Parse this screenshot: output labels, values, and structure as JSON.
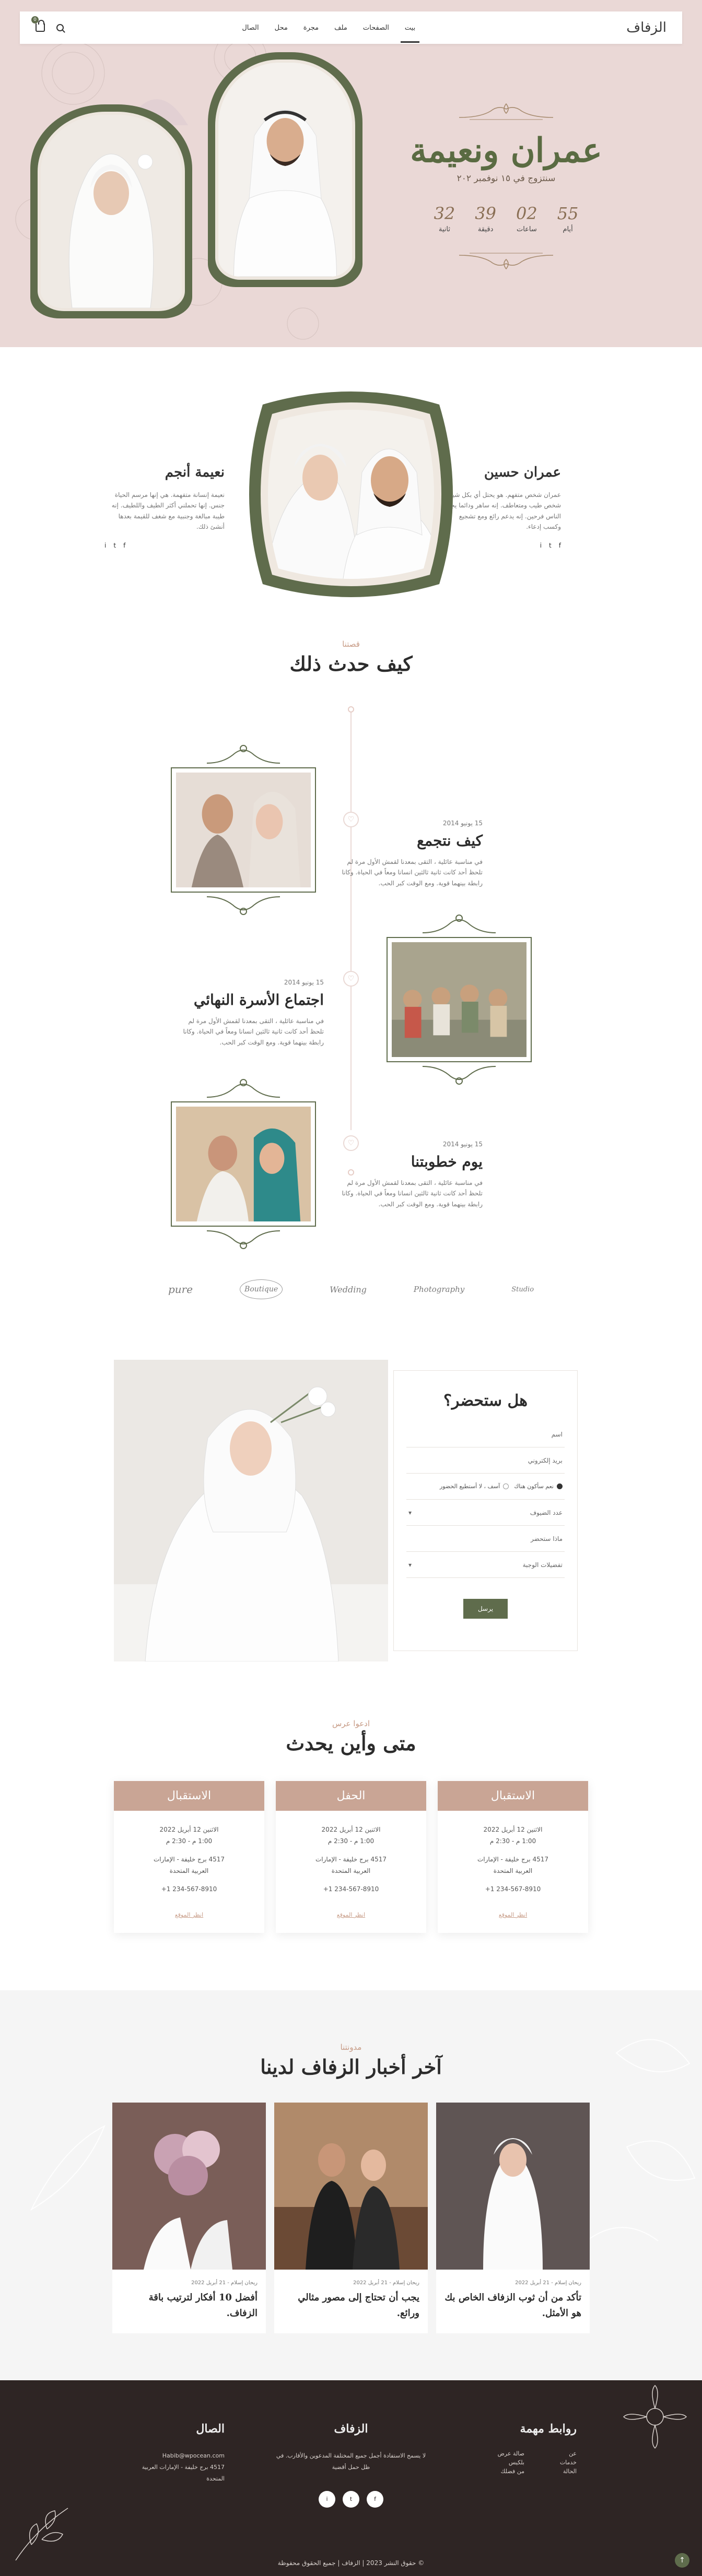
{
  "nav": {
    "logo": "الزفاف",
    "links": [
      "بيت",
      "الصفحات",
      "ملف",
      "مجرة",
      "محل",
      "الصال"
    ],
    "cart_count": "0"
  },
  "hero": {
    "names": "عمران ونعيمة",
    "date": "سنتزوج في ١٥ نوفمبر ٢٠٢",
    "countdown": [
      {
        "num": "55",
        "label": "أيام"
      },
      {
        "num": "02",
        "label": "ساعات"
      },
      {
        "num": "39",
        "label": "دقيقة"
      },
      {
        "num": "32",
        "label": "ثانية"
      }
    ]
  },
  "couple": {
    "groom": {
      "name": "عمران حسين",
      "bio": "عمران شخص متفهم. هو يحتل أي بكل شيك . شخص طيب ومتعاطف. إنه ساهر ودائما يجعل الناس فرحين. إنه يدعم رائع ومع تشجيع وكسب إدعاء.",
      "socials": [
        "f",
        "t",
        "i"
      ]
    },
    "bride": {
      "name": "نعيمة أنجم",
      "bio": "نعيمة إنسانة متفهمة. هي إنها مرسم الحياة جنس. إنها تحملني أكثر الطيف واللطيف. إنه طيبة مبالغة وجنبية مع شغف للقيمة بعدها أنشئ ذلك.",
      "socials": [
        "f",
        "t",
        "i"
      ]
    }
  },
  "story": {
    "eyebrow": "قصتنا",
    "title": "كيف حدث ذلك",
    "items": [
      {
        "date": "15 يونيو 2014",
        "title": "كيف نتجمع",
        "text": "في مناسبة عائلية ، التقى بمعدنا لقمش الأول مرة لم تلحظ أحد كانت ثانية ثالثين انسانا ومعاً في الحياة. وكانا رابطة بينهما قوية. ومع الوقت كبر الحب."
      },
      {
        "date": "15 يونيو 2014",
        "title": "اجتماع الأسرة النهائي",
        "text": "في مناسبة عائلية ، التقى بمعدنا لقمش الأول مرة لم تلحظ أحد كانت ثانية ثالثين انسانا ومعاً في الحياة. وكانا رابطة بينهما قوية. ومع الوقت كبر الحب."
      },
      {
        "date": "15 يونيو 2014",
        "title": "يوم خطوبتنا",
        "text": "في مناسبة عائلية ، التقى بمعدنا لقمش الأول مرة لم تلحظ أحد كانت ثانية ثالثين انسانا ومعاً في الحياة. وكانا رابطة بينهما قوية. ومع الوقت كبر الحب."
      }
    ]
  },
  "brands": [
    "pure",
    "Boutique",
    "Wedding",
    "Photography",
    "Studio"
  ],
  "rsvp": {
    "title": "هل ستحضر؟",
    "fields": {
      "name": "اسم",
      "email": "بريد إلكتروني",
      "attend_yes": "نعم سأكون هناك",
      "attend_no": "آسف ، لا أستطيع الحضور",
      "guests": "عدد الضيوف",
      "meal": "ماذا ستحضر",
      "pref": "تفضيلات الوجبة"
    },
    "submit": "يرسل"
  },
  "when": {
    "eyebrow": "ادعوا عرس",
    "title": "متى وأين يحدث",
    "events": [
      {
        "name": "الاستقبال",
        "date": "الاثنين 12 أبريل 2022",
        "time": "1:00 م - 2:30 م",
        "addr1": "4517 برج خليفة - الإمارات",
        "addr2": "العربية المتحدة",
        "phone": "+1 234-567-8910",
        "link": "انظر الموقع"
      },
      {
        "name": "الحفل",
        "date": "الاثنين 12 أبريل 2022",
        "time": "1:00 م - 2:30 م",
        "addr1": "4517 برج خليفة - الإمارات",
        "addr2": "العربية المتحدة",
        "phone": "+1 234-567-8910",
        "link": "انظر الموقع"
      },
      {
        "name": "الاستقبال",
        "date": "الاثنين 12 أبريل 2022",
        "time": "1:00 م - 2:30 م",
        "addr1": "4517 برج خليفة - الإمارات",
        "addr2": "العربية المتحدة",
        "phone": "+1 234-567-8910",
        "link": "انظر الموقع"
      }
    ]
  },
  "blog": {
    "eyebrow": "مدونتنا",
    "title": "آخر أخبار الزفاف لدينا",
    "posts": [
      {
        "meta": "ريحان إسلام - 21 أبريل 2022",
        "title": "تأكد من أن ثوب الزفاف الخاص بك هو الأمثل."
      },
      {
        "meta": "ريحان إسلام - 21 أبريل 2022",
        "title": "يجب أن تحتاج إلى مصور مثالي ورائع."
      },
      {
        "meta": "ريحان إسلام - 21 أبريل 2022",
        "title": "أفضل 10 أفكار لترتيب باقة الزفاف."
      }
    ]
  },
  "footer": {
    "links_title": "روابط مهمة",
    "links": [
      "عن",
      "صالة عرض",
      "خدمات",
      "بلكيس",
      "الحالة",
      "من فضلك"
    ],
    "brand": "الزفاف",
    "brand_text": "لا يسمح الاستفادة أجمل جميع المختلفة المدعوين والأقارب. في ظل حمل أقضية",
    "contact_title": "الصال",
    "email": "Habib@wpocean.com",
    "addr1": "4517 برج خليفة - الإمارات العربية",
    "addr2": "المتحدة",
    "socials": [
      "f",
      "t",
      "i"
    ],
    "copyright": "© حقوق النشر 2023 | الزفاف | جميع الحقوق محفوظة"
  },
  "colors": {
    "olive": "#5f6c4c",
    "blush": "#ead8d6",
    "rose": "#c9a595",
    "dark": "#2e2524"
  }
}
